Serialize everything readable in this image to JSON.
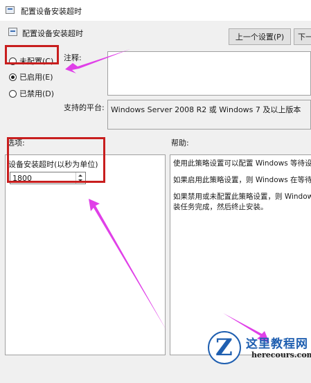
{
  "window": {
    "title": "配置设备安装超时"
  },
  "header": {
    "title": "配置设备安装超时"
  },
  "nav": {
    "prev_label": "上一个设置(P)",
    "next_label": "下一个设置(N)"
  },
  "radios": [
    {
      "label": "未配置(C)",
      "checked": false
    },
    {
      "label": "已启用(E)",
      "checked": true
    },
    {
      "label": "已禁用(D)",
      "checked": false
    }
  ],
  "comment": {
    "label": "注释:",
    "value": ""
  },
  "platform": {
    "label": "支持的平台:",
    "value": "Windows Server 2008 R2 或 Windows 7 及以上版本"
  },
  "options": {
    "label": "选项:",
    "field_label": "设备安装超时(以秒为单位)",
    "value": "1800"
  },
  "help": {
    "label": "帮助:",
    "paragraphs": [
      "使用此策略设置可以配置 Windows 等待设",
      "如果启用此策略设置，则 Windows 在等待",
      "如果禁用或未配置此策略设置，则 Window\n装任务完成，然后终止安装。"
    ]
  },
  "watermark": {
    "brand": "这里教程网",
    "url": "herecours.com",
    "logo_letter": "Z"
  },
  "colors": {
    "highlight": "#c81e1e",
    "arrow": "#e040e8",
    "brand": "#1f5fb0"
  }
}
